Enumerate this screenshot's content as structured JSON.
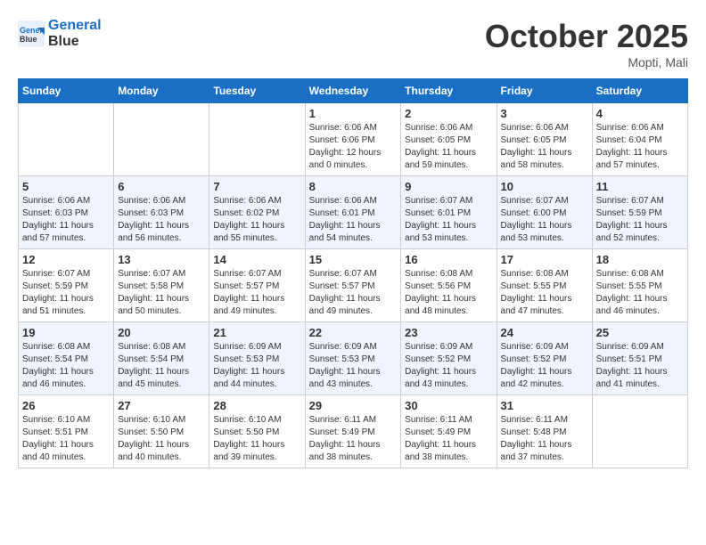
{
  "header": {
    "logo_line1": "General",
    "logo_line2": "Blue",
    "month_title": "October 2025",
    "location": "Mopti, Mali"
  },
  "weekdays": [
    "Sunday",
    "Monday",
    "Tuesday",
    "Wednesday",
    "Thursday",
    "Friday",
    "Saturday"
  ],
  "weeks": [
    [
      {
        "day": "",
        "info": ""
      },
      {
        "day": "",
        "info": ""
      },
      {
        "day": "",
        "info": ""
      },
      {
        "day": "1",
        "info": "Sunrise: 6:06 AM\nSunset: 6:06 PM\nDaylight: 12 hours\nand 0 minutes."
      },
      {
        "day": "2",
        "info": "Sunrise: 6:06 AM\nSunset: 6:05 PM\nDaylight: 11 hours\nand 59 minutes."
      },
      {
        "day": "3",
        "info": "Sunrise: 6:06 AM\nSunset: 6:05 PM\nDaylight: 11 hours\nand 58 minutes."
      },
      {
        "day": "4",
        "info": "Sunrise: 6:06 AM\nSunset: 6:04 PM\nDaylight: 11 hours\nand 57 minutes."
      }
    ],
    [
      {
        "day": "5",
        "info": "Sunrise: 6:06 AM\nSunset: 6:03 PM\nDaylight: 11 hours\nand 57 minutes."
      },
      {
        "day": "6",
        "info": "Sunrise: 6:06 AM\nSunset: 6:03 PM\nDaylight: 11 hours\nand 56 minutes."
      },
      {
        "day": "7",
        "info": "Sunrise: 6:06 AM\nSunset: 6:02 PM\nDaylight: 11 hours\nand 55 minutes."
      },
      {
        "day": "8",
        "info": "Sunrise: 6:06 AM\nSunset: 6:01 PM\nDaylight: 11 hours\nand 54 minutes."
      },
      {
        "day": "9",
        "info": "Sunrise: 6:07 AM\nSunset: 6:01 PM\nDaylight: 11 hours\nand 53 minutes."
      },
      {
        "day": "10",
        "info": "Sunrise: 6:07 AM\nSunset: 6:00 PM\nDaylight: 11 hours\nand 53 minutes."
      },
      {
        "day": "11",
        "info": "Sunrise: 6:07 AM\nSunset: 5:59 PM\nDaylight: 11 hours\nand 52 minutes."
      }
    ],
    [
      {
        "day": "12",
        "info": "Sunrise: 6:07 AM\nSunset: 5:59 PM\nDaylight: 11 hours\nand 51 minutes."
      },
      {
        "day": "13",
        "info": "Sunrise: 6:07 AM\nSunset: 5:58 PM\nDaylight: 11 hours\nand 50 minutes."
      },
      {
        "day": "14",
        "info": "Sunrise: 6:07 AM\nSunset: 5:57 PM\nDaylight: 11 hours\nand 49 minutes."
      },
      {
        "day": "15",
        "info": "Sunrise: 6:07 AM\nSunset: 5:57 PM\nDaylight: 11 hours\nand 49 minutes."
      },
      {
        "day": "16",
        "info": "Sunrise: 6:08 AM\nSunset: 5:56 PM\nDaylight: 11 hours\nand 48 minutes."
      },
      {
        "day": "17",
        "info": "Sunrise: 6:08 AM\nSunset: 5:55 PM\nDaylight: 11 hours\nand 47 minutes."
      },
      {
        "day": "18",
        "info": "Sunrise: 6:08 AM\nSunset: 5:55 PM\nDaylight: 11 hours\nand 46 minutes."
      }
    ],
    [
      {
        "day": "19",
        "info": "Sunrise: 6:08 AM\nSunset: 5:54 PM\nDaylight: 11 hours\nand 46 minutes."
      },
      {
        "day": "20",
        "info": "Sunrise: 6:08 AM\nSunset: 5:54 PM\nDaylight: 11 hours\nand 45 minutes."
      },
      {
        "day": "21",
        "info": "Sunrise: 6:09 AM\nSunset: 5:53 PM\nDaylight: 11 hours\nand 44 minutes."
      },
      {
        "day": "22",
        "info": "Sunrise: 6:09 AM\nSunset: 5:53 PM\nDaylight: 11 hours\nand 43 minutes."
      },
      {
        "day": "23",
        "info": "Sunrise: 6:09 AM\nSunset: 5:52 PM\nDaylight: 11 hours\nand 43 minutes."
      },
      {
        "day": "24",
        "info": "Sunrise: 6:09 AM\nSunset: 5:52 PM\nDaylight: 11 hours\nand 42 minutes."
      },
      {
        "day": "25",
        "info": "Sunrise: 6:09 AM\nSunset: 5:51 PM\nDaylight: 11 hours\nand 41 minutes."
      }
    ],
    [
      {
        "day": "26",
        "info": "Sunrise: 6:10 AM\nSunset: 5:51 PM\nDaylight: 11 hours\nand 40 minutes."
      },
      {
        "day": "27",
        "info": "Sunrise: 6:10 AM\nSunset: 5:50 PM\nDaylight: 11 hours\nand 40 minutes."
      },
      {
        "day": "28",
        "info": "Sunrise: 6:10 AM\nSunset: 5:50 PM\nDaylight: 11 hours\nand 39 minutes."
      },
      {
        "day": "29",
        "info": "Sunrise: 6:11 AM\nSunset: 5:49 PM\nDaylight: 11 hours\nand 38 minutes."
      },
      {
        "day": "30",
        "info": "Sunrise: 6:11 AM\nSunset: 5:49 PM\nDaylight: 11 hours\nand 38 minutes."
      },
      {
        "day": "31",
        "info": "Sunrise: 6:11 AM\nSunset: 5:48 PM\nDaylight: 11 hours\nand 37 minutes."
      },
      {
        "day": "",
        "info": ""
      }
    ]
  ]
}
